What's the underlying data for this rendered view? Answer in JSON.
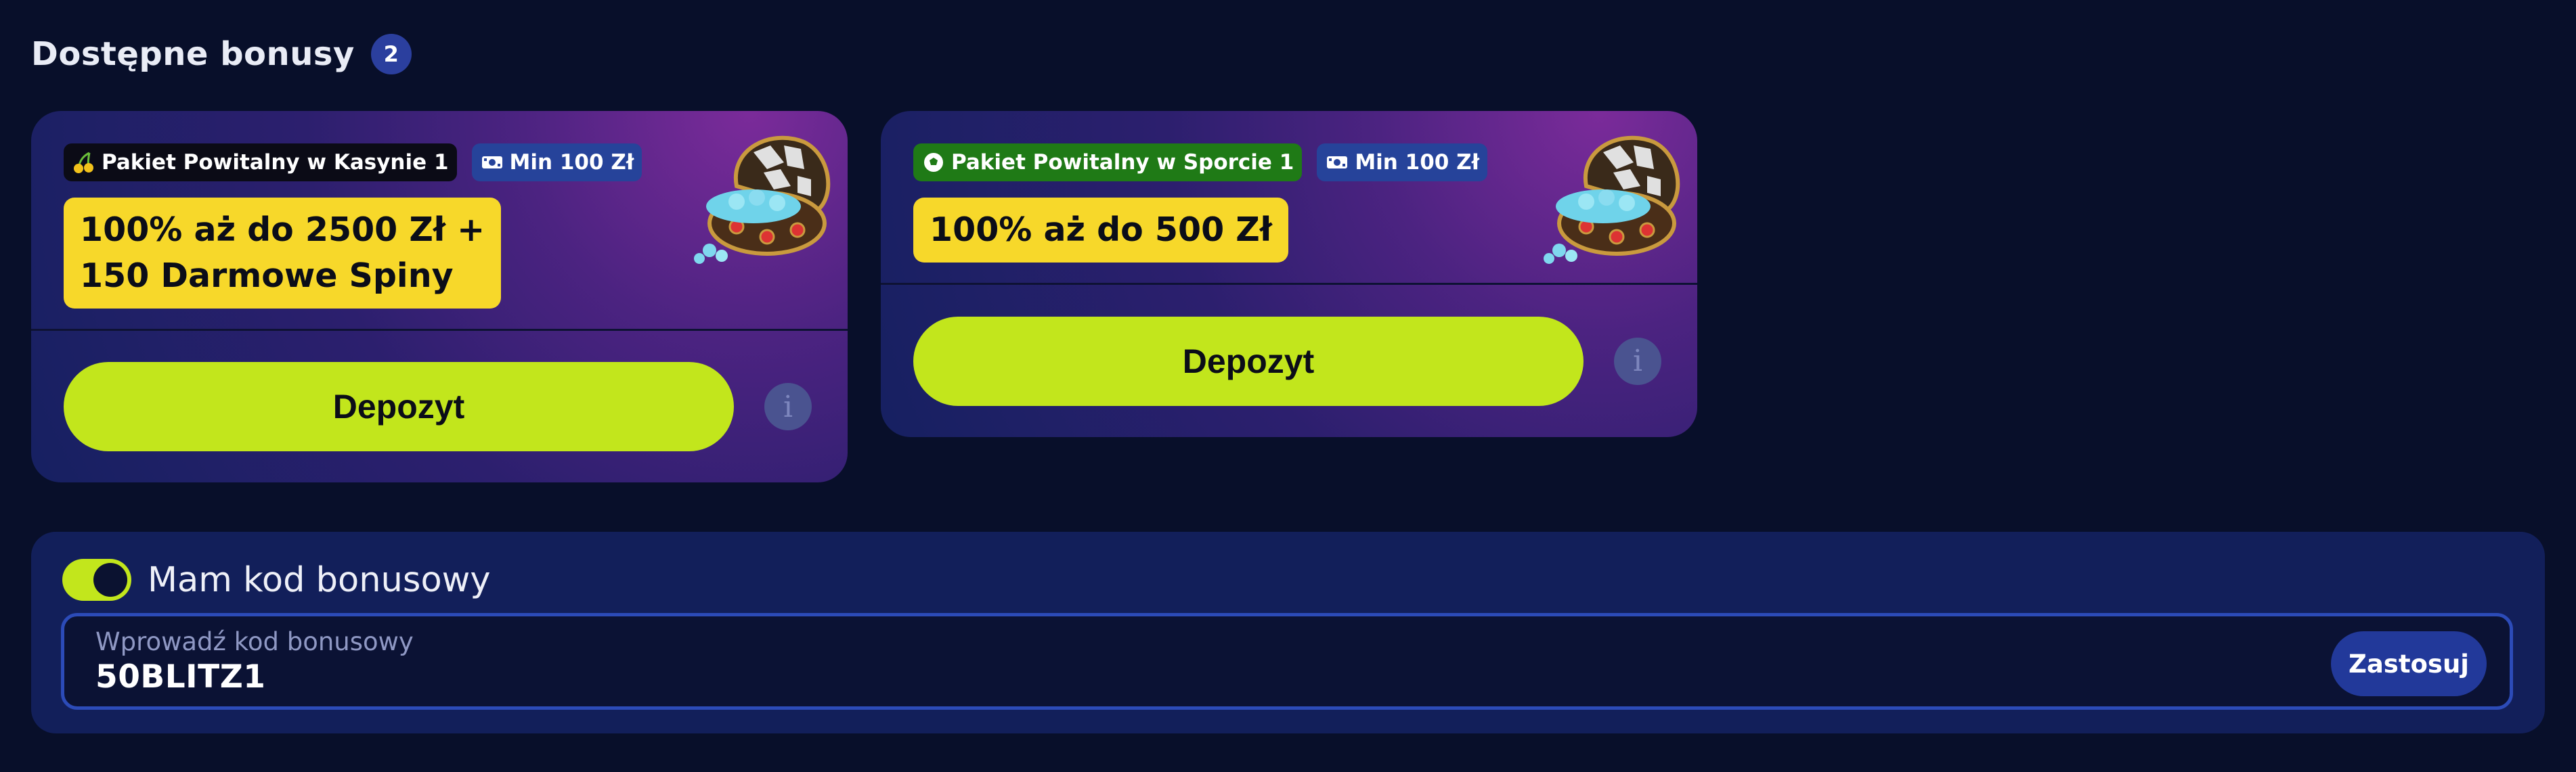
{
  "header": {
    "title": "Dostępne bonusy",
    "count": "2"
  },
  "bonuses": [
    {
      "tag_icon": "cherries-icon",
      "tag": "Pakiet Powitalny w Kasynie 1",
      "min_icon": "banknote-icon",
      "min": "Min 100 Zł",
      "offer_line1": "100% aż do 2500 Zł +",
      "offer_line2": "150 Darmowe Spiny",
      "image": "treasure-chest-icon",
      "button": "Depozyt",
      "info": "i"
    },
    {
      "tag_icon": "soccer-ball-icon",
      "tag": "Pakiet Powitalny w Sporcie 1",
      "min_icon": "banknote-icon",
      "min": "Min 100 Zł",
      "offer_line1": "100% aż do 500 Zł",
      "image": "treasure-chest-icon",
      "button": "Depozyt",
      "info": "i"
    }
  ],
  "bonus_code": {
    "toggle_on": true,
    "toggle_label": "Mam kod bonusowy",
    "input_label": "Wprowadź kod bonusowy",
    "input_value": "50BLITZ1",
    "apply_button": "Zastosuj"
  },
  "colors": {
    "background": "#080f2a",
    "accent_green": "#c2e61c",
    "offer_yellow": "#f7d82a",
    "sport_tag": "#1f7a16",
    "min_tag": "#26439a",
    "panel": "#121f5a",
    "field_border": "#2c4bb8"
  }
}
